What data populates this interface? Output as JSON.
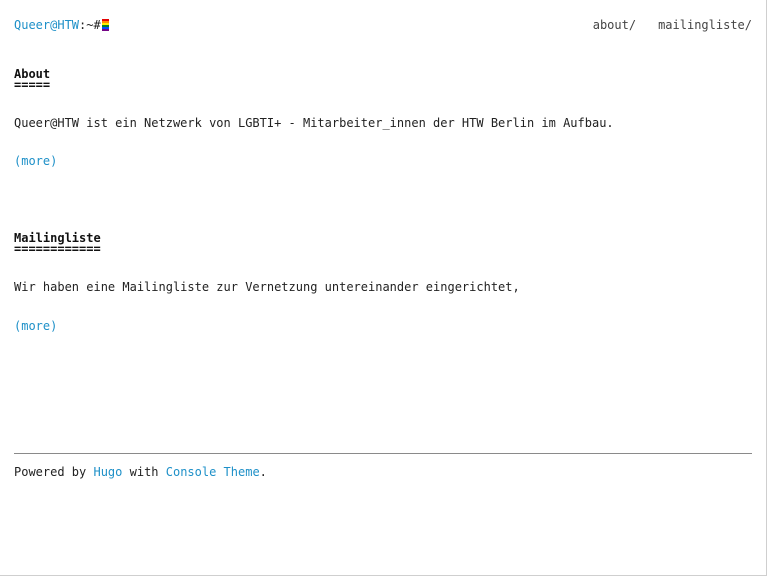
{
  "header": {
    "brand": "Queer@HTW",
    "prompt": ":~#",
    "nav": [
      {
        "label": "about/"
      },
      {
        "label": "mailingliste/"
      }
    ]
  },
  "posts": [
    {
      "title": "About",
      "underline": "=====",
      "summary": "Queer@HTW ist ein Netzwerk von LGBTI+ - Mitarbeiter_innen der HTW Berlin im Aufbau.",
      "more": "(more)"
    },
    {
      "title": "Mailingliste",
      "underline": "============",
      "summary": "Wir haben eine Mailingliste zur Vernetzung untereinander eingerichtet,",
      "more": "(more)"
    }
  ],
  "footer": {
    "prefix": "Powered by ",
    "hugo": "Hugo",
    "middle": " with ",
    "theme": "Console Theme",
    "suffix": "."
  },
  "colors": {
    "link": "#1e90c8",
    "text": "#222222",
    "rule": "#8a8a8a"
  }
}
